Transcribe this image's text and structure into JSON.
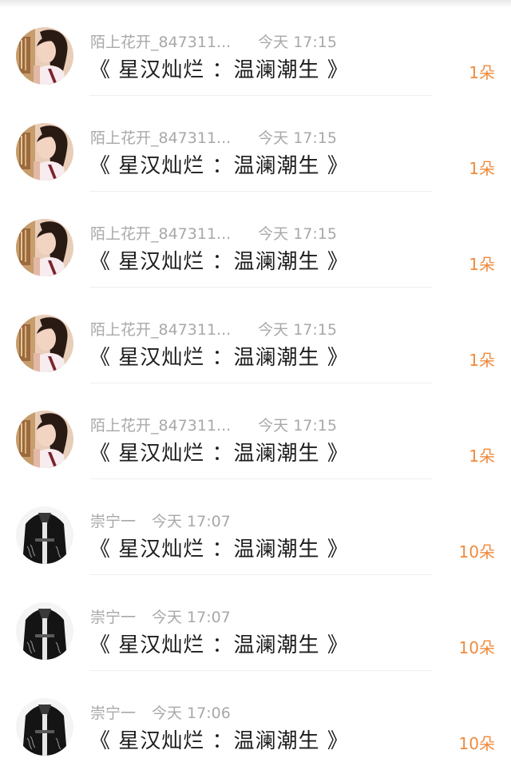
{
  "gifts": [
    {
      "user": "陌上花开_847311...",
      "time": "今天 17:15",
      "title": "《 星汉灿烂 ：温澜潮生 》",
      "amount": "1朵",
      "avatar": "girl-portrait-icon"
    },
    {
      "user": "陌上花开_847311...",
      "time": "今天 17:15",
      "title": "《 星汉灿烂 ：温澜潮生 》",
      "amount": "1朵",
      "avatar": "girl-portrait-icon"
    },
    {
      "user": "陌上花开_847311...",
      "time": "今天 17:15",
      "title": "《 星汉灿烂 ：温澜潮生 》",
      "amount": "1朵",
      "avatar": "girl-portrait-icon"
    },
    {
      "user": "陌上花开_847311...",
      "time": "今天 17:15",
      "title": "《 星汉灿烂 ：温澜潮生 》",
      "amount": "1朵",
      "avatar": "girl-portrait-icon"
    },
    {
      "user": "陌上花开_847311...",
      "time": "今天 17:15",
      "title": "《 星汉灿烂 ：温澜潮生 》",
      "amount": "1朵",
      "avatar": "girl-portrait-icon"
    },
    {
      "user": "崇宁一",
      "time": "今天 17:07",
      "title": "《 星汉灿烂 ：温澜潮生 》",
      "amount": "10朵",
      "avatar": "black-robe-figure-icon"
    },
    {
      "user": "崇宁一",
      "time": "今天 17:07",
      "title": "《 星汉灿烂 ：温澜潮生 》",
      "amount": "10朵",
      "avatar": "black-robe-figure-icon"
    },
    {
      "user": "崇宁一",
      "time": "今天 17:06",
      "title": "《 星汉灿烂 ：温澜潮生 》",
      "amount": "10朵",
      "avatar": "black-robe-figure-icon"
    }
  ],
  "colors": {
    "amount": "#f08a3c",
    "meta": "#a8a8a8",
    "title": "#1c1c1c"
  }
}
